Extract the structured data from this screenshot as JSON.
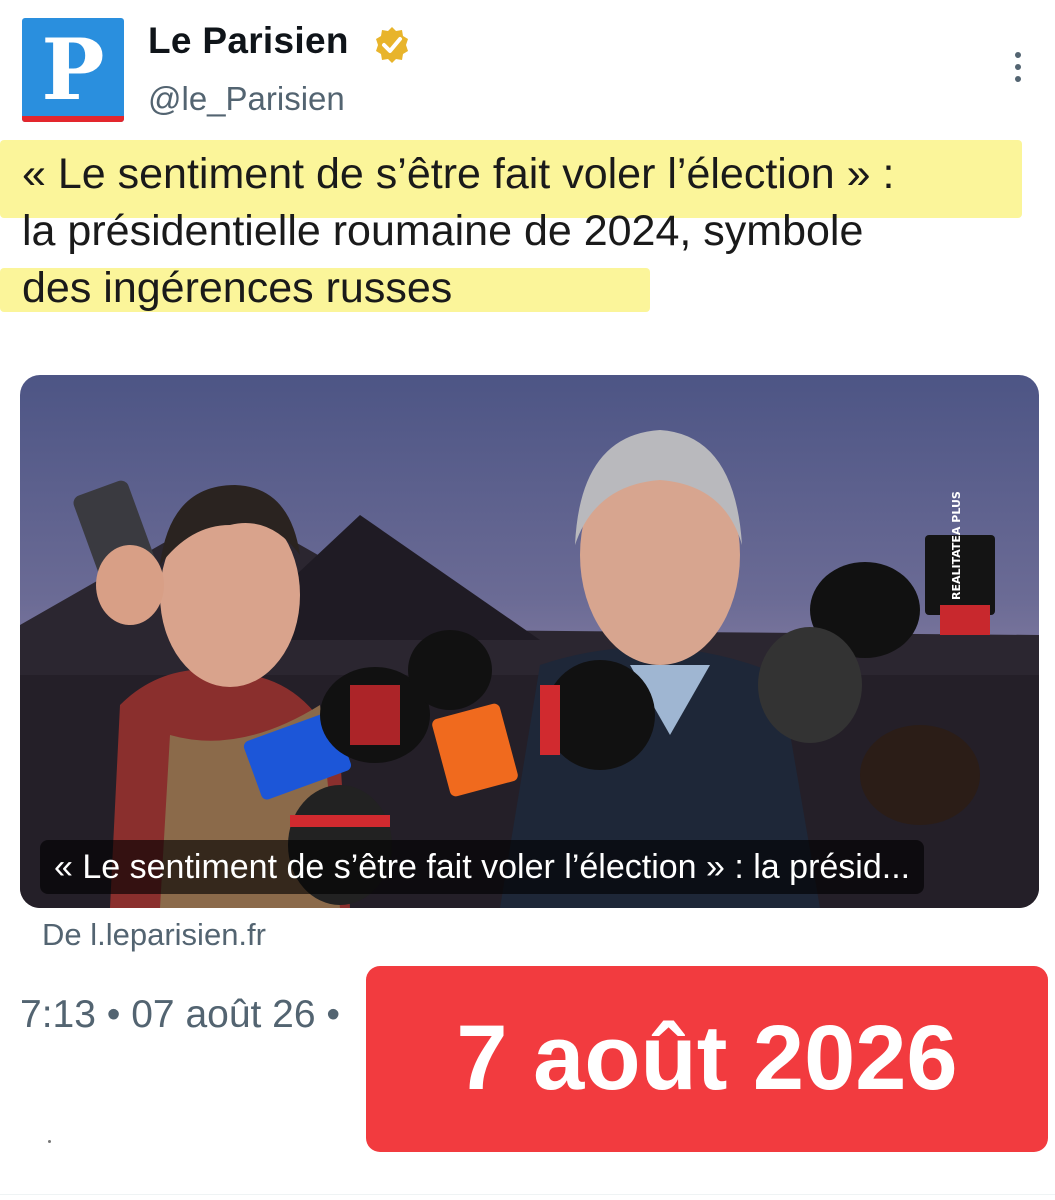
{
  "account": {
    "name": "Le Parisien",
    "handle": "@le_Parisien",
    "avatar_letter": "P",
    "avatar_color": "#2a8fde",
    "avatar_bar_color": "#e3262d",
    "verified_icon": "verified-gold-badge"
  },
  "tweet": {
    "headline_line1": "« Le sentiment de s’être fait voler l’élection » :",
    "headline_line2": "la présidentielle roumaine de 2024, symbole",
    "headline_line3": "des ingérences russes",
    "highlight_color": "#fbf59a"
  },
  "link_card": {
    "caption": "« Le sentiment de s’être fait voler l’élection » : la présid...",
    "mic_flag_label": "REALITATEA PLUS",
    "source": "De l.leparisien.fr"
  },
  "meta": {
    "time": "7:13 • 07 août 26 •"
  },
  "overlay": {
    "date_label": "7 août 2026",
    "color": "#f23b3f"
  }
}
